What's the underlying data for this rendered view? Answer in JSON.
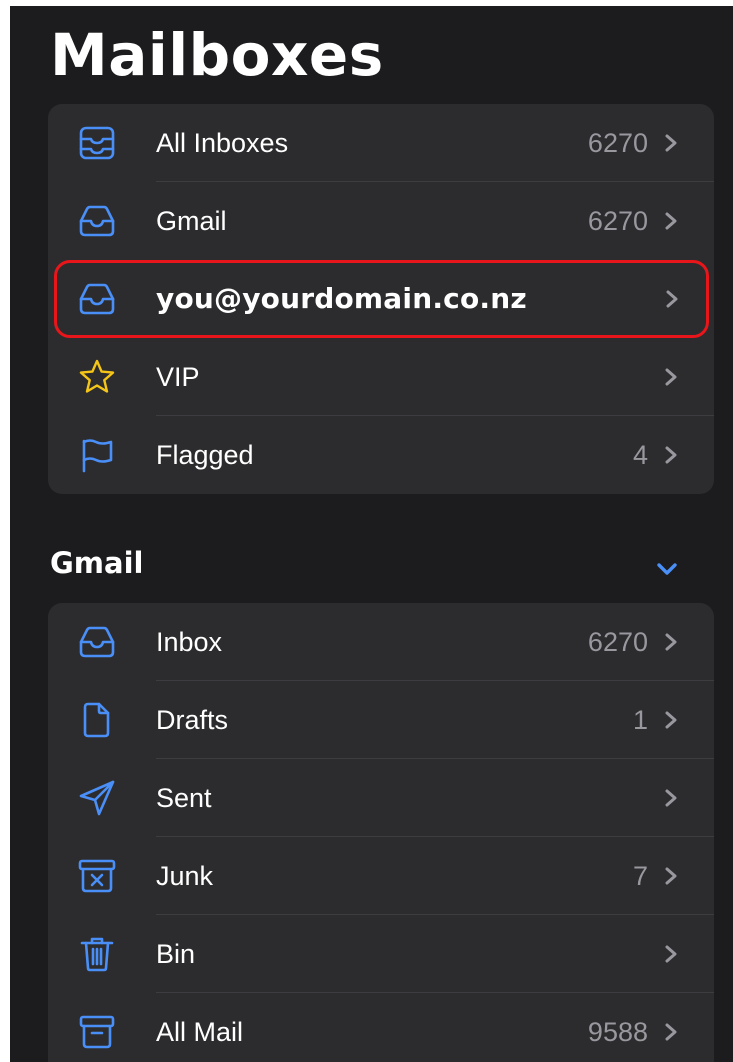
{
  "header": {
    "title": "Mailboxes"
  },
  "colors": {
    "accent": "#4a8ff7",
    "vip_star": "#f5c518",
    "highlight_box": "#e8161a",
    "background": "#1c1c1e",
    "group": "#2c2c2e"
  },
  "mailboxes": [
    {
      "label": "All Inboxes",
      "count": "6270",
      "icon": "all-inboxes-icon"
    },
    {
      "label": "Gmail",
      "count": "6270",
      "icon": "inbox-tray-icon"
    },
    {
      "label": "you@yourdomain.co.nz",
      "count": "",
      "icon": "inbox-tray-icon"
    },
    {
      "label": "VIP",
      "count": "",
      "icon": "star-icon"
    },
    {
      "label": "Flagged",
      "count": "4",
      "icon": "flag-icon"
    }
  ],
  "gmail_section": {
    "title": "Gmail",
    "folders": [
      {
        "label": "Inbox",
        "count": "6270",
        "icon": "inbox-tray-icon"
      },
      {
        "label": "Drafts",
        "count": "1",
        "icon": "document-icon"
      },
      {
        "label": "Sent",
        "count": "",
        "icon": "paper-plane-icon"
      },
      {
        "label": "Junk",
        "count": "7",
        "icon": "junk-box-icon"
      },
      {
        "label": "Bin",
        "count": "",
        "icon": "trash-icon"
      },
      {
        "label": "All Mail",
        "count": "9588",
        "icon": "archive-box-icon"
      }
    ]
  }
}
